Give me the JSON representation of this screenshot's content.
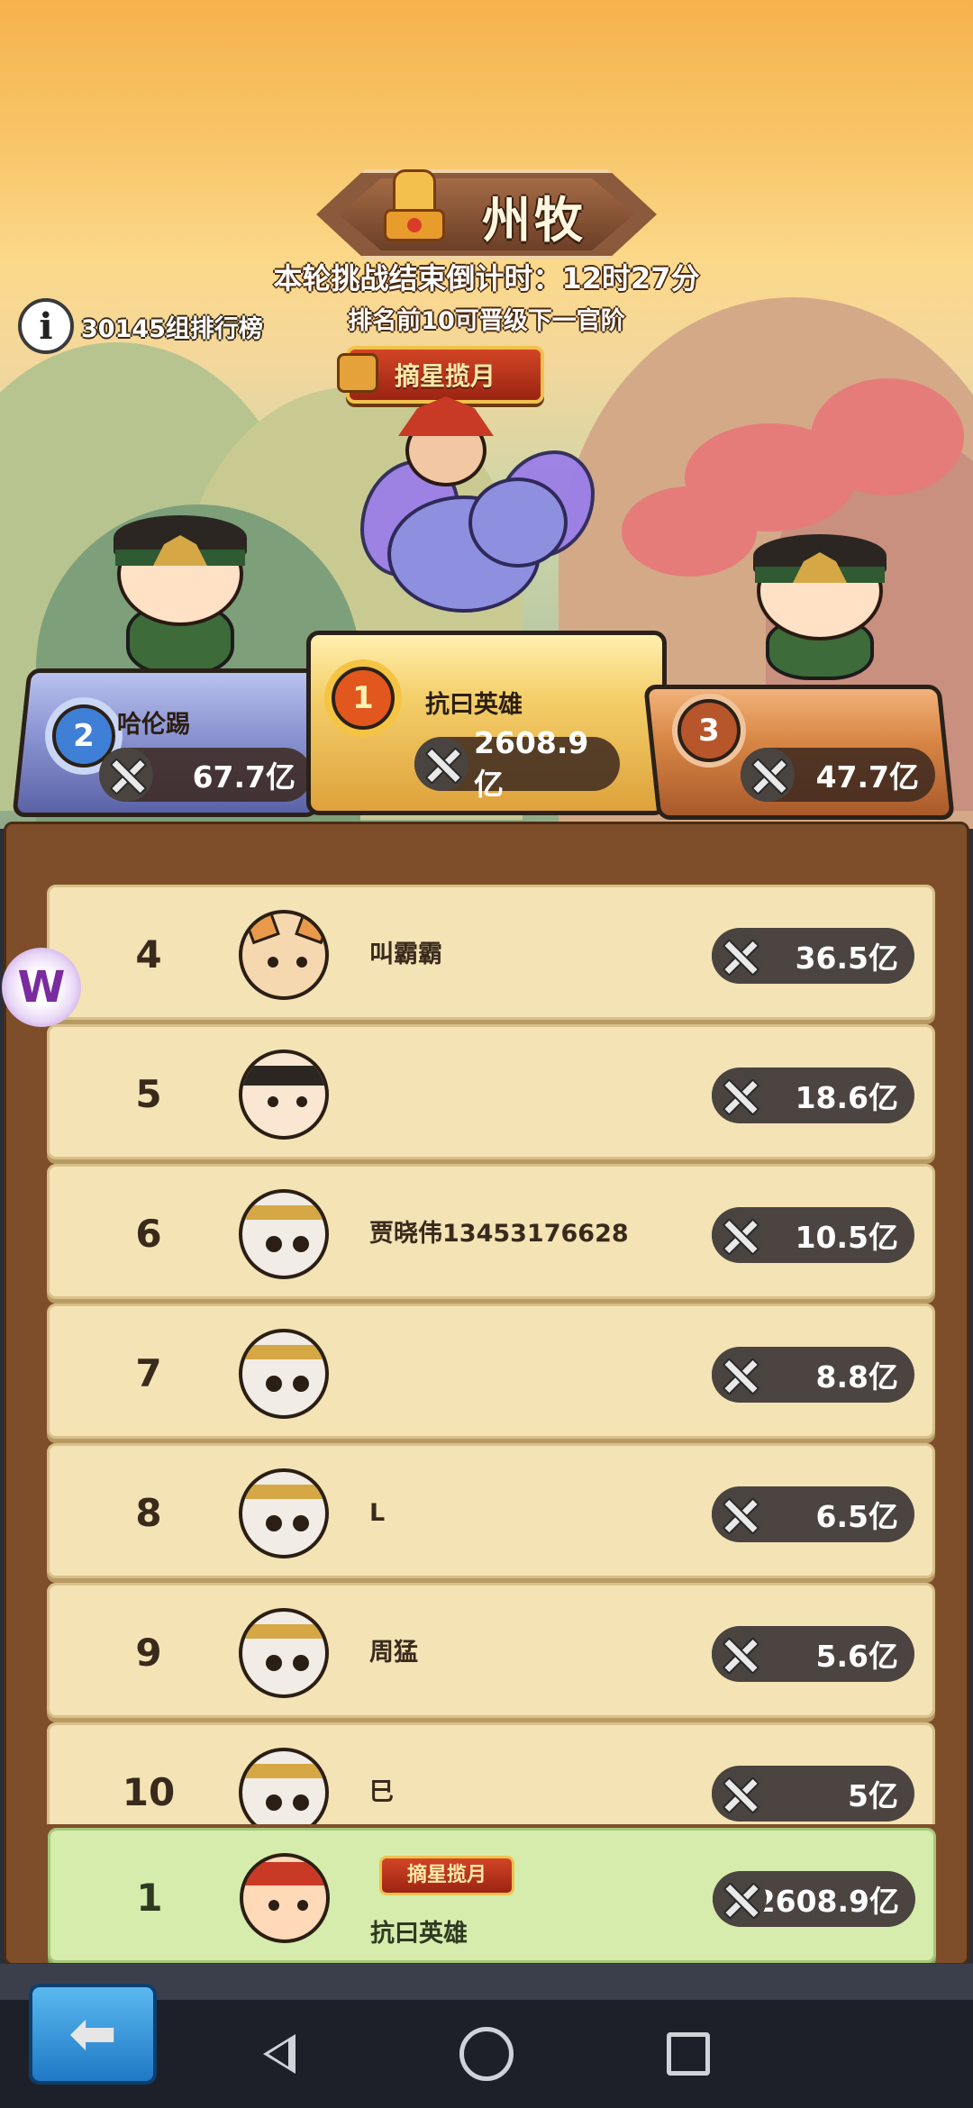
{
  "header": {
    "rank_title": "州牧",
    "countdown": "本轮挑战结束倒计时：12时27分",
    "promotion_note": "排名前10可晋级下一官阶",
    "group_label": "30145组排行榜",
    "title_badge": "摘星揽月"
  },
  "podium": {
    "first": {
      "rank": "1",
      "name": "抗曰英雄",
      "power": "2608.9亿"
    },
    "second": {
      "rank": "2",
      "name": "哈伦踢",
      "power": "67.7亿"
    },
    "third": {
      "rank": "3",
      "name": "",
      "power": "47.7亿"
    }
  },
  "ranking": [
    {
      "rank": "4",
      "name": "叫霸霸",
      "power": "36.5亿",
      "avatar": "corgi"
    },
    {
      "rank": "5",
      "name": "",
      "power": "18.6亿",
      "avatar": "warrior"
    },
    {
      "rank": "6",
      "name": "贾晓伟13453176628",
      "power": "10.5亿",
      "avatar": "panda"
    },
    {
      "rank": "7",
      "name": "",
      "power": "8.8亿",
      "avatar": "panda"
    },
    {
      "rank": "8",
      "name": "L",
      "power": "6.5亿",
      "avatar": "panda"
    },
    {
      "rank": "9",
      "name": "周猛",
      "power": "5.6亿",
      "avatar": "panda"
    },
    {
      "rank": "10",
      "name": "巳",
      "power": "5亿",
      "avatar": "panda"
    }
  ],
  "self": {
    "rank": "1",
    "badge": "摘星揽月",
    "name": "抗曰英雄",
    "power": "2608.9亿"
  },
  "floating_button": "W",
  "colors": {
    "list_bg": "#7e4e2a",
    "row_bg": "#f4e3b5",
    "self_bg": "#d5ecac",
    "gold": "#f4cf6a"
  }
}
